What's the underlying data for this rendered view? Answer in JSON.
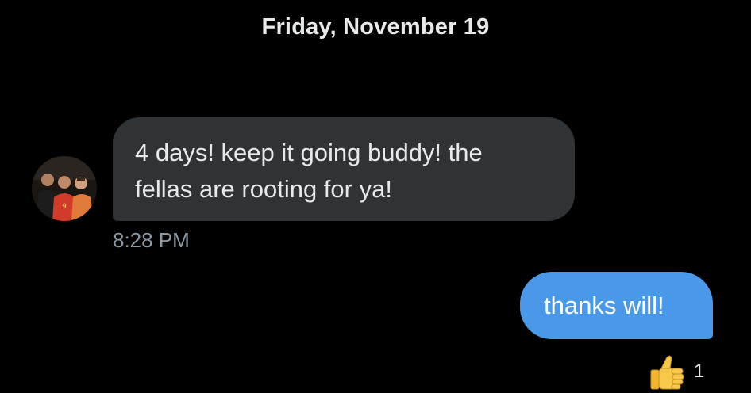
{
  "conversation": {
    "date_header": "Friday, November 19",
    "incoming": {
      "text": "4 days! keep it going buddy! the fellas are rooting for ya!",
      "line1": "4 days! keep it going buddy! the",
      "line2": "fellas are rooting for ya!",
      "timestamp": "8:28 PM"
    },
    "outgoing": {
      "text": "thanks will!"
    },
    "reaction": {
      "emoji": "thumbs-up-icon",
      "count": "1"
    }
  },
  "colors": {
    "background": "#000000",
    "incoming_bubble": "#2f3336",
    "outgoing_bubble": "#4a99e9",
    "timestamp": "#8b98a5",
    "text": "#e7e9ea"
  }
}
